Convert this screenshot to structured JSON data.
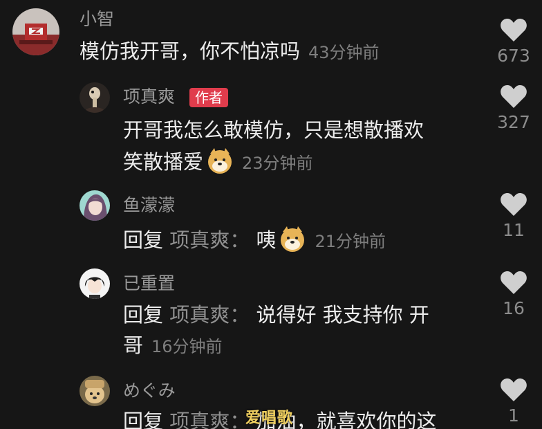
{
  "colors": {
    "background": "#161616",
    "author_badge": "#e03c4c",
    "username": "#9a9a9a",
    "timestamp": "#7e7e7e",
    "like_icon": "#cfcfcf"
  },
  "comments": [
    {
      "user": "小智",
      "text": "模仿我开哥，你不怕凉吗",
      "time": "43分钟前",
      "likes": "673",
      "avatar": "tower-photo-avatar"
    },
    {
      "user": "项真爽",
      "badge": "作者",
      "text_line1": "开哥我怎么敢模仿，只是想散播欢",
      "text_line2": "笑散播爱",
      "emoji": "doge-emoji",
      "time": "23分钟前",
      "likes": "327",
      "avatar": "ostrich-photo-avatar"
    },
    {
      "user": "鱼濛濛",
      "reply_prefix": "回复",
      "reply_target": "项真爽：",
      "text": "咦",
      "emoji": "doge-emoji",
      "time": "21分钟前",
      "likes": "11",
      "avatar": "anime-girl-avatar"
    },
    {
      "user": "已重置",
      "reply_prefix": "回复",
      "reply_target": "项真爽：",
      "text_line1": "说得好 我支持你 开",
      "text_line2": "哥",
      "time": "16分钟前",
      "likes": "16",
      "avatar": "anime-boy-avatar"
    },
    {
      "user": "めぐみ",
      "reply_prefix": "回复",
      "reply_target": "项真爽：",
      "text": "加油，就喜欢你的这",
      "likes": "1",
      "avatar": "dog-photo-avatar"
    }
  ],
  "watermark": "爱唱歌"
}
